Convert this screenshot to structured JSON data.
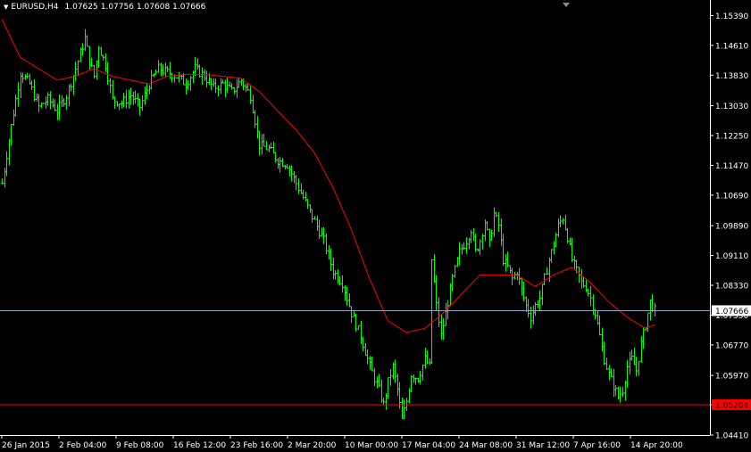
{
  "header": {
    "symbol_tf": "EURUSD,H4",
    "open": "1.07625",
    "high": "1.07756",
    "low": "1.07608",
    "close": "1.07666"
  },
  "colors": {
    "background": "#000000",
    "bars": "#00FF00",
    "moving_average": "#FF0000",
    "bid_line": "#8FA8C8",
    "level_line": "#FF0000",
    "axis": "#FFFFFF",
    "bid_label_bg": "#FFFFFF",
    "level_label_bg": "#FF0000"
  },
  "chart_data": {
    "type": "candlestick-ohlc-bars",
    "symbol": "EURUSD",
    "timeframe": "H4",
    "ylim": [
      1.0441,
      1.1575
    ],
    "y_ticks": [
      "1.15390",
      "1.14610",
      "1.13830",
      "1.13030",
      "1.12250",
      "1.11470",
      "1.10690",
      "1.09890",
      "1.09110",
      "1.08330",
      "1.07550",
      "1.06770",
      "1.05970",
      "1.05204",
      "1.04410"
    ],
    "x_labels": [
      "26 Jan 2015",
      "2 Feb 04:00",
      "9 Feb 08:00",
      "16 Feb 12:00",
      "23 Feb 16:00",
      "2 Mar 20:00",
      "10 Mar 00:00",
      "17 Mar 04:00",
      "24 Mar 08:00",
      "31 Mar 12:00",
      "7 Apr 16:00",
      "14 Apr 20:00"
    ],
    "current_price": "1.07666",
    "horizontal_level": "1.05204",
    "close_path": [
      [
        0,
        1.11
      ],
      [
        4,
        1.125
      ],
      [
        8,
        1.139
      ],
      [
        12,
        1.136
      ],
      [
        16,
        1.13
      ],
      [
        20,
        1.132
      ],
      [
        24,
        1.129
      ],
      [
        28,
        1.133
      ],
      [
        32,
        1.14
      ],
      [
        36,
        1.148
      ],
      [
        38,
        1.142
      ],
      [
        40,
        1.138
      ],
      [
        42,
        1.146
      ],
      [
        45,
        1.141
      ],
      [
        48,
        1.132
      ],
      [
        52,
        1.131
      ],
      [
        56,
        1.133
      ],
      [
        60,
        1.13
      ],
      [
        64,
        1.136
      ],
      [
        68,
        1.14
      ],
      [
        72,
        1.139
      ],
      [
        76,
        1.138
      ],
      [
        80,
        1.136
      ],
      [
        84,
        1.14
      ],
      [
        88,
        1.138
      ],
      [
        92,
        1.135
      ],
      [
        96,
        1.136
      ],
      [
        100,
        1.134
      ],
      [
        104,
        1.137
      ],
      [
        108,
        1.133
      ],
      [
        112,
        1.12
      ],
      [
        116,
        1.119
      ],
      [
        120,
        1.116
      ],
      [
        124,
        1.115
      ],
      [
        128,
        1.11
      ],
      [
        132,
        1.105
      ],
      [
        136,
        1.1
      ],
      [
        140,
        1.095
      ],
      [
        144,
        1.087
      ],
      [
        148,
        1.084
      ],
      [
        152,
        1.076
      ],
      [
        156,
        1.07
      ],
      [
        160,
        1.062
      ],
      [
        164,
        1.056
      ],
      [
        166,
        1.052
      ],
      [
        168,
        1.058
      ],
      [
        170,
        1.062
      ],
      [
        172,
        1.056
      ],
      [
        174,
        1.048
      ],
      [
        176,
        1.053
      ],
      [
        178,
        1.06
      ],
      [
        181,
        1.059
      ],
      [
        184,
        1.064
      ],
      [
        186,
        1.062
      ],
      [
        187,
        1.09
      ],
      [
        189,
        1.078
      ],
      [
        191,
        1.07
      ],
      [
        193,
        1.076
      ],
      [
        196,
        1.085
      ],
      [
        199,
        1.092
      ],
      [
        202,
        1.095
      ],
      [
        204,
        1.098
      ],
      [
        206,
        1.092
      ],
      [
        208,
        1.095
      ],
      [
        210,
        1.1
      ],
      [
        212,
        1.094
      ],
      [
        214,
        1.102
      ],
      [
        216,
        1.099
      ],
      [
        218,
        1.09
      ],
      [
        220,
        1.088
      ],
      [
        222,
        1.085
      ],
      [
        224,
        1.087
      ],
      [
        226,
        1.082
      ],
      [
        228,
        1.078
      ],
      [
        230,
        1.075
      ],
      [
        232,
        1.078
      ],
      [
        234,
        1.08
      ],
      [
        236,
        1.085
      ],
      [
        238,
        1.09
      ],
      [
        240,
        1.094
      ],
      [
        242,
        1.099
      ],
      [
        244,
        1.101
      ],
      [
        246,
        1.096
      ],
      [
        248,
        1.09
      ],
      [
        250,
        1.087
      ],
      [
        252,
        1.084
      ],
      [
        254,
        1.083
      ],
      [
        256,
        1.08
      ],
      [
        258,
        1.076
      ],
      [
        260,
        1.07
      ],
      [
        262,
        1.064
      ],
      [
        264,
        1.06
      ],
      [
        266,
        1.057
      ],
      [
        268,
        1.054
      ],
      [
        270,
        1.056
      ],
      [
        272,
        1.062
      ],
      [
        274,
        1.064
      ],
      [
        276,
        1.061
      ],
      [
        278,
        1.068
      ],
      [
        280,
        1.073
      ],
      [
        282,
        1.079
      ],
      [
        284,
        1.0767
      ]
    ],
    "moving_average": [
      [
        0,
        1.153
      ],
      [
        8,
        1.143
      ],
      [
        16,
        1.14
      ],
      [
        24,
        1.137
      ],
      [
        32,
        1.138
      ],
      [
        40,
        1.14
      ],
      [
        48,
        1.138
      ],
      [
        56,
        1.137
      ],
      [
        64,
        1.136
      ],
      [
        72,
        1.138
      ],
      [
        80,
        1.1385
      ],
      [
        88,
        1.1385
      ],
      [
        96,
        1.138
      ],
      [
        104,
        1.1375
      ],
      [
        112,
        1.134
      ],
      [
        120,
        1.129
      ],
      [
        128,
        1.124
      ],
      [
        136,
        1.118
      ],
      [
        144,
        1.109
      ],
      [
        152,
        1.098
      ],
      [
        160,
        1.085
      ],
      [
        168,
        1.074
      ],
      [
        176,
        1.071
      ],
      [
        184,
        1.072
      ],
      [
        192,
        1.076
      ],
      [
        200,
        1.081
      ],
      [
        208,
        1.086
      ],
      [
        216,
        1.086
      ],
      [
        224,
        1.086
      ],
      [
        232,
        1.083
      ],
      [
        240,
        1.086
      ],
      [
        248,
        1.088
      ],
      [
        256,
        1.084
      ],
      [
        264,
        1.079
      ],
      [
        272,
        1.075
      ],
      [
        280,
        1.072
      ],
      [
        284,
        1.073
      ]
    ]
  }
}
